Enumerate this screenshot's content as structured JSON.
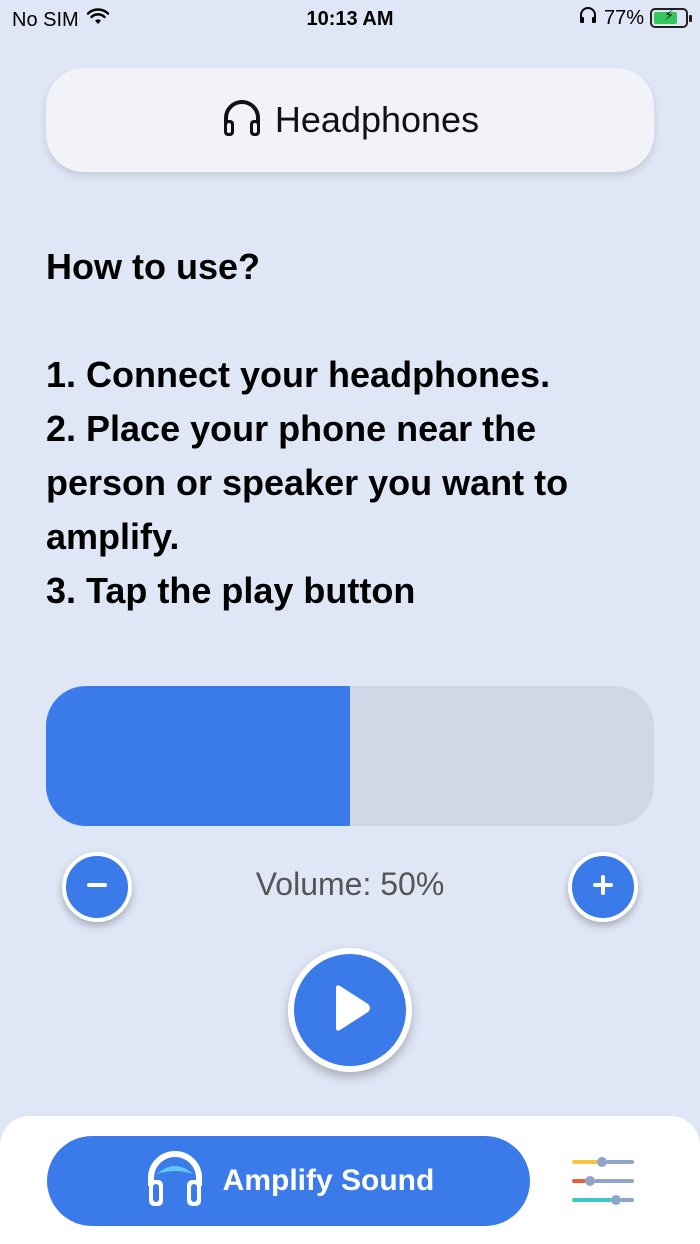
{
  "status_bar": {
    "carrier": "No SIM",
    "time": "10:13 AM",
    "battery": "77%"
  },
  "header": {
    "title": "Headphones",
    "icon": "headphones-icon"
  },
  "instructions": {
    "heading": "How to use?",
    "steps": [
      "1. Connect your headphones.",
      "2. Place your phone near the person or speaker you want to amplify.",
      "3. Tap the play button"
    ]
  },
  "volume": {
    "label": "Volume: 50%",
    "level": 0.5,
    "fill_color": "#3b7be9",
    "track_color": "#d0d7e6"
  },
  "controls": {
    "minus_icon": "minus-icon",
    "plus_icon": "plus-icon",
    "play_icon": "play-icon"
  },
  "bottom_bar": {
    "amplify_label": "Amplify Sound",
    "amplify_icon": "headphones-icon",
    "equalizer_icon": "equalizer-icon"
  },
  "colors": {
    "accent": "#3b7be9",
    "background": "#dfe6f5"
  }
}
